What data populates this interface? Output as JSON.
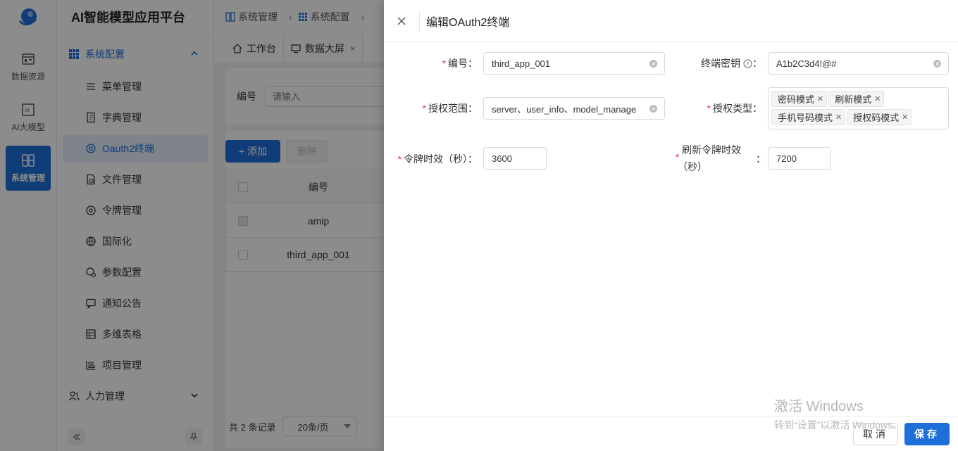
{
  "platform_title": "AI智能模型应用平台",
  "rail": [
    {
      "label": "数据资源",
      "icon": "database-icon"
    },
    {
      "label": "AI大模型",
      "icon": "ai-icon"
    },
    {
      "label": "系统管理",
      "icon": "system-icon",
      "active": true
    }
  ],
  "sidebar": {
    "group_label": "系统配置",
    "items": [
      {
        "label": "菜单管理",
        "icon": "menu-icon"
      },
      {
        "label": "字典管理",
        "icon": "dictionary-icon"
      },
      {
        "label": "Oauth2终端",
        "icon": "oauth-icon",
        "active": true
      },
      {
        "label": "文件管理",
        "icon": "file-icon"
      },
      {
        "label": "令牌管理",
        "icon": "token-icon"
      },
      {
        "label": "国际化",
        "icon": "globe-icon"
      },
      {
        "label": "参数配置",
        "icon": "param-icon"
      },
      {
        "label": "通知公告",
        "icon": "notice-icon"
      },
      {
        "label": "多维表格",
        "icon": "table-icon"
      },
      {
        "label": "项目管理",
        "icon": "project-icon"
      }
    ],
    "group2_label": "人力管理"
  },
  "breadcrumb": [
    "系统管理",
    "系统配置"
  ],
  "tabs": [
    {
      "label": "工作台",
      "icon": "home-icon"
    },
    {
      "label": "数据大屏",
      "icon": "monitor-icon",
      "closable": "×"
    }
  ],
  "filter": {
    "label": "编号",
    "placeholder": "请输入"
  },
  "table": {
    "add_label": "+ 添加",
    "delete_label": "删除",
    "header_code": "编号",
    "rows": [
      "amip",
      "third_app_001"
    ],
    "total": "共 2 条记录",
    "page_size": "20条/页"
  },
  "drawer": {
    "title": "编辑OAuth2终端",
    "fields": {
      "code_label": "编号",
      "code_value": "third_app_001",
      "secret_label": "终端密钥",
      "secret_value": "A1b2C3d4!@#",
      "scope_label": "授权范围",
      "scope_value": "server、user_info、model_manage",
      "grant_label": "授权类型",
      "grant_tags": [
        "密码模式",
        "刷新模式",
        "手机号码模式",
        "授权码模式"
      ],
      "token_label": "令牌时效（秒）",
      "token_value": "3600",
      "refresh_label_line1": "刷新令牌时效",
      "refresh_label_line2": "（秒）",
      "refresh_value": "7200"
    },
    "cancel_label": "取消",
    "save_label": "保存"
  },
  "watermark": {
    "line1": "激活 Windows",
    "line2": "转到“设置”以激活 Windows。"
  },
  "colors": {
    "primary": "#1e6fd9",
    "required": "#e4393c"
  }
}
